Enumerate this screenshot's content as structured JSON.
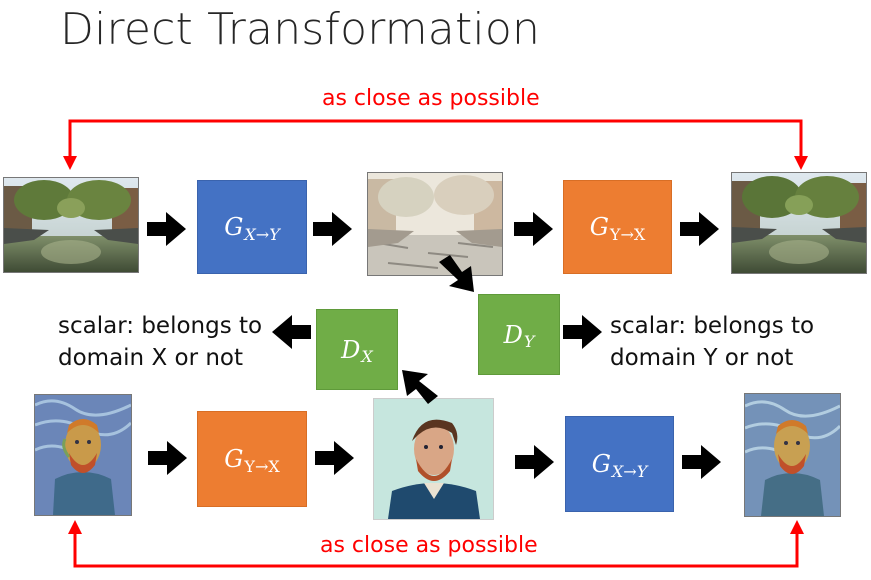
{
  "title": "Direct Transformation",
  "top_loop_label": "as close as possible",
  "bottom_loop_label": "as close as possible",
  "generators": {
    "g_xy_top": {
      "base": "G",
      "sub_from": "X",
      "sub_arrow": "→",
      "sub_to": "Y"
    },
    "g_yx_top": {
      "base": "G",
      "sub_from": "Y",
      "sub_arrow": "→",
      "sub_to": "X"
    },
    "g_yx_bottom": {
      "base": "G",
      "sub_from": "Y",
      "sub_arrow": "→",
      "sub_to": "X"
    },
    "g_xy_bottom": {
      "base": "G",
      "sub_from": "X",
      "sub_arrow": "→",
      "sub_to": "Y"
    }
  },
  "discriminators": {
    "d_x": {
      "base": "D",
      "sub": "X"
    },
    "d_y": {
      "base": "D",
      "sub": "Y"
    }
  },
  "scalar_left": {
    "line1": "scalar: belongs to",
    "line2": "domain X or not"
  },
  "scalar_right": {
    "line1": "scalar: belongs to",
    "line2": "domain Y or not"
  },
  "colors": {
    "blue_box": "#4472c4",
    "orange_box": "#ed7d31",
    "green_box": "#70ad47",
    "loop_arrow": "#ff0000",
    "flow_arrow": "#000000"
  },
  "images": [
    "canal-photo-original",
    "canal-painting-generated",
    "canal-photo-reconstructed",
    "van-gogh-painting-original",
    "van-gogh-photo-generated",
    "van-gogh-painting-reconstructed"
  ]
}
